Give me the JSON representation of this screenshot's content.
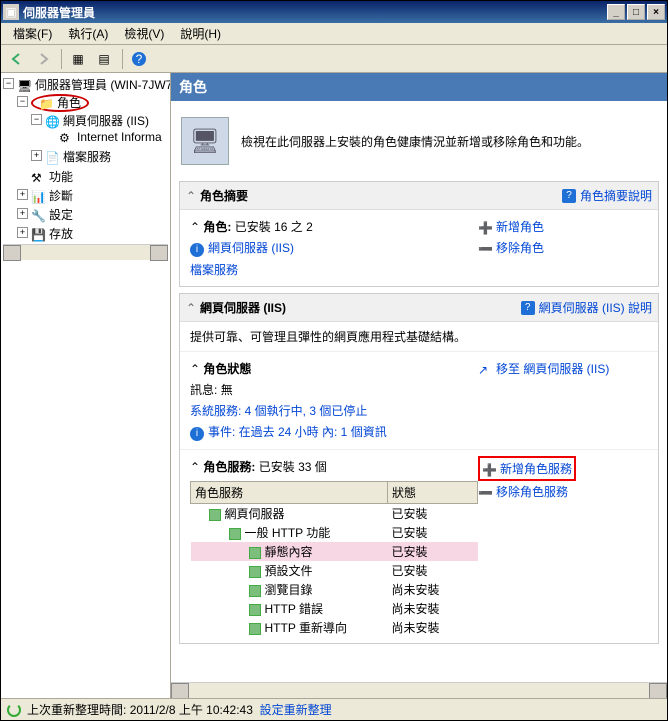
{
  "window": {
    "title": "伺服器管理員"
  },
  "menu": {
    "file": "檔案(F)",
    "exec": "執行(A)",
    "view": "檢視(V)",
    "help": "說明(H)"
  },
  "tree": {
    "root": "伺服器管理員 (WIN-7JW7",
    "roles": "角色",
    "iis": "網頁伺服器 (IIS)",
    "iis_sub": "Internet Informa",
    "fileservice": "檔案服務",
    "features": "功能",
    "diag": "診斷",
    "config": "設定",
    "storage": "存放"
  },
  "header": {
    "title": "角色"
  },
  "desc": "檢視在此伺服器上安裝的角色健康情況並新增或移除角色和功能。",
  "summary": {
    "title": "角色摘要",
    "help": "角色摘要說明",
    "installed_label": "角色:",
    "installed_value": "已安裝 16 之 2",
    "iis": "網頁伺服器 (IIS)",
    "fs": "檔案服務",
    "add": "新增角色",
    "remove": "移除角色"
  },
  "iis_section": {
    "title": "網頁伺服器 (IIS)",
    "help": "網頁伺服器 (IIS) 說明",
    "desc": "提供可靠、可管理且彈性的網頁應用程式基礎結構。",
    "status_title": "角色狀態",
    "goto": "移至 網頁伺服器 (IIS)",
    "msg_label": "訊息:",
    "msg_value": "無",
    "svc": "系統服務: 4 個執行中, 3 個已停止",
    "events": "事件: 在過去 24 小時 內: 1 個資訊",
    "rs_title": "角色服務:",
    "rs_value": "已安裝 33 個",
    "rs_add": "新增角色服務",
    "rs_remove": "移除角色服務",
    "cols": {
      "name": "角色服務",
      "status": "狀態"
    },
    "rows": [
      {
        "name": "網頁伺服器",
        "status": "已安裝",
        "indent": 0
      },
      {
        "name": "一般 HTTP 功能",
        "status": "已安裝",
        "indent": 1
      },
      {
        "name": "靜態內容",
        "status": "已安裝",
        "indent": 2,
        "hl": true
      },
      {
        "name": "預設文件",
        "status": "已安裝",
        "indent": 2
      },
      {
        "name": "瀏覽目錄",
        "status": "尚未安裝",
        "indent": 2
      },
      {
        "name": "HTTP 錯誤",
        "status": "尚未安裝",
        "indent": 2
      },
      {
        "name": "HTTP 重新導向",
        "status": "尚未安裝",
        "indent": 2
      }
    ]
  },
  "status": {
    "label": "上次重新整理時間:",
    "time": "2011/2/8 上午 10:42:43",
    "link": "設定重新整理"
  }
}
